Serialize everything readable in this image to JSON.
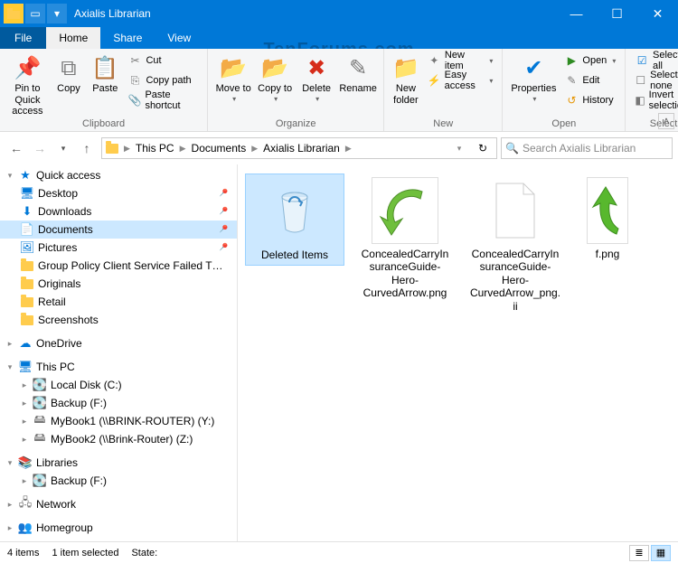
{
  "window": {
    "title": "Axialis Librarian"
  },
  "menubar": {
    "file": "File",
    "tabs": [
      "Home",
      "Share",
      "View"
    ],
    "active": 0
  },
  "ribbon": {
    "groups": {
      "clipboard": {
        "label": "Clipboard",
        "pin": "Pin to Quick access",
        "copy": "Copy",
        "paste": "Paste",
        "cut": "Cut",
        "copy_path": "Copy path",
        "paste_shortcut": "Paste shortcut"
      },
      "organize": {
        "label": "Organize",
        "move_to": "Move to",
        "copy_to": "Copy to",
        "delete": "Delete",
        "rename": "Rename"
      },
      "new": {
        "label": "New",
        "new_folder": "New folder",
        "new_item": "New item",
        "easy_access": "Easy access"
      },
      "open": {
        "label": "Open",
        "properties": "Properties",
        "open": "Open",
        "edit": "Edit",
        "history": "History"
      },
      "select": {
        "label": "Select",
        "select_all": "Select all",
        "select_none": "Select none",
        "invert": "Invert selection"
      }
    }
  },
  "address": {
    "crumbs": [
      "This PC",
      "Documents",
      "Axialis Librarian"
    ],
    "search_placeholder": "Search Axialis Librarian"
  },
  "nav": {
    "quick_access": {
      "label": "Quick access",
      "icon": "star"
    },
    "quick_items": [
      {
        "label": "Desktop",
        "icon": "desktop",
        "pinned": true
      },
      {
        "label": "Downloads",
        "icon": "download",
        "pinned": true
      },
      {
        "label": "Documents",
        "icon": "document",
        "pinned": true,
        "selected": true
      },
      {
        "label": "Pictures",
        "icon": "picture",
        "pinned": true
      },
      {
        "label": "Group Policy Client Service Failed The Logon",
        "icon": "folder"
      },
      {
        "label": "Originals",
        "icon": "folder"
      },
      {
        "label": "Retail",
        "icon": "folder"
      },
      {
        "label": "Screenshots",
        "icon": "folder"
      }
    ],
    "onedrive": "OneDrive",
    "thispc": {
      "label": "This PC",
      "items": [
        {
          "label": "Local Disk (C:)",
          "icon": "drive"
        },
        {
          "label": "Backup (F:)",
          "icon": "drive"
        },
        {
          "label": "MyBook1 (\\\\BRINK-ROUTER) (Y:)",
          "icon": "netdrive"
        },
        {
          "label": "MyBook2 (\\\\Brink-Router) (Z:)",
          "icon": "netdrive"
        }
      ]
    },
    "libraries": {
      "label": "Libraries",
      "items": [
        {
          "label": "Backup (F:)",
          "icon": "drive"
        }
      ]
    },
    "network": "Network",
    "homegroup": "Homegroup"
  },
  "files": [
    {
      "name": "Deleted Items",
      "kind": "recyclebin",
      "selected": true
    },
    {
      "name": "ConcealedCarryInsuranceGuide-Hero-CurvedArrow.png",
      "kind": "arrow-big"
    },
    {
      "name": "ConcealedCarryInsuranceGuide-Hero-CurvedArrow_png.ii",
      "kind": "blank"
    },
    {
      "name": "f.png",
      "kind": "arrow-small"
    }
  ],
  "status": {
    "count": "4 items",
    "selected": "1 item selected",
    "state_label": "State:"
  },
  "watermark": "TenForums.com"
}
